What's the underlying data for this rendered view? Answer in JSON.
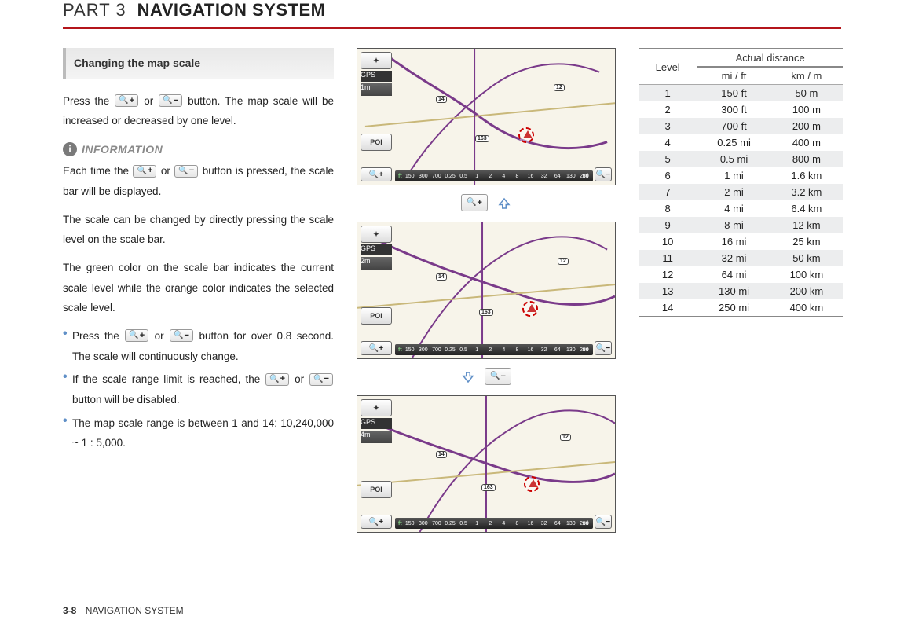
{
  "header": {
    "part_label": "PART 3",
    "title": "NAVIGATION SYSTEM"
  },
  "section_heading": "Changing the map scale",
  "intro": {
    "pre": "Press the ",
    "mid": " or ",
    "post": " button. The map scale will be increased or decreased by one level."
  },
  "info": {
    "title": "INFORMATION",
    "p1_pre": "Each time the ",
    "p1_mid": " or ",
    "p1_post": " button is pressed, the scale bar will be displayed.",
    "p2": "The scale can be changed by directly pressing the scale level on the scale bar.",
    "p3": "The green color on the scale bar indicates the current scale level while the orange color indicates the selected scale level.",
    "b1_pre": "Press the ",
    "b1_mid": " or ",
    "b1_post": " button for over 0.8 second. The scale will continuously change.",
    "b2_pre": "If the scale range limit is reached, the ",
    "b2_mid": " or ",
    "b2_post": " button will be disabled.",
    "b3": "The map scale range is between 1 and 14: 10,240,000 ~ 1 : 5,000."
  },
  "maps": {
    "gps_label": "GPS",
    "poi_label": "POI",
    "scales": [
      "1mi",
      "2mi",
      "4mi"
    ],
    "route_a": "14",
    "route_b": "12",
    "route_c": "163",
    "scalebar_left_unit": "ft",
    "scalebar_right_unit": "mi",
    "scalebar_ticks": [
      "150",
      "300",
      "700",
      "0.25",
      "0.5",
      "1",
      "2",
      "4",
      "8",
      "16",
      "32",
      "64",
      "130",
      "250"
    ]
  },
  "table": {
    "level_header": "Level",
    "distance_header": "Actual distance",
    "col_mi": "mi / ft",
    "col_km": "km / m",
    "rows": [
      {
        "level": "1",
        "mi": "150 ft",
        "km": "50 m"
      },
      {
        "level": "2",
        "mi": "300 ft",
        "km": "100 m"
      },
      {
        "level": "3",
        "mi": "700 ft",
        "km": "200 m"
      },
      {
        "level": "4",
        "mi": "0.25 mi",
        "km": "400 m"
      },
      {
        "level": "5",
        "mi": "0.5 mi",
        "km": "800 m"
      },
      {
        "level": "6",
        "mi": "1 mi",
        "km": "1.6 km"
      },
      {
        "level": "7",
        "mi": "2 mi",
        "km": "3.2 km"
      },
      {
        "level": "8",
        "mi": "4 mi",
        "km": "6.4 km"
      },
      {
        "level": "9",
        "mi": "8 mi",
        "km": "12 km"
      },
      {
        "level": "10",
        "mi": "16 mi",
        "km": "25 km"
      },
      {
        "level": "11",
        "mi": "32 mi",
        "km": "50 km"
      },
      {
        "level": "12",
        "mi": "64 mi",
        "km": "100 km"
      },
      {
        "level": "13",
        "mi": "130 mi",
        "km": "200 km"
      },
      {
        "level": "14",
        "mi": "250 mi",
        "km": "400 km"
      }
    ]
  },
  "footer": {
    "page_num": "3-8",
    "label": "NAVIGATION SYSTEM"
  },
  "icons": {
    "zoom_in_sign": "+",
    "zoom_out_sign": "−",
    "compass": "✦"
  }
}
